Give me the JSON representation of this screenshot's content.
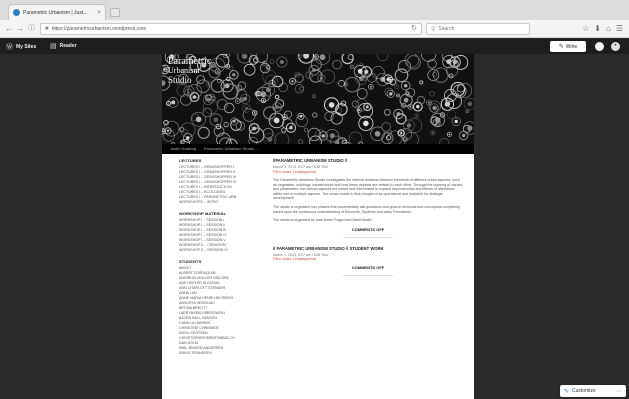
{
  "browser": {
    "tab_title": "Parametric Urbanism | Just...",
    "tab_close": "×",
    "url": "https://parametricurbanism.wordpress.com",
    "search_placeholder": "Search",
    "reload": "↻",
    "back": "←",
    "forward": "→",
    "lock": "🔒",
    "info": "ⓘ",
    "icons": [
      "☆",
      "⬇",
      "⌂",
      "☰"
    ]
  },
  "adminbar": {
    "my_sites": "My Sites",
    "reader": "Reader",
    "write": "Write"
  },
  "site": {
    "title_lines": [
      "Parametric",
      "Urbanism",
      "Studio"
    ],
    "strip_text": "Justin Hosking ...   ·   Parametric Urbanism Studio ..."
  },
  "sidebar": {
    "sections": [
      {
        "heading": "LECTURES",
        "items": [
          "LECTURES I – GRASSHOPPER I",
          "LECTURES I – GRASSHOPPER II",
          "LECTURES I – GRASSHOPPER III",
          "LECTURES I – GRASSHOPPER IV",
          "LECTURES I – INTRODUCTION",
          "LECTURES I – ECOLOGIES",
          "LECTURES I – PARAMETRIC URB.",
          "WORKSHOPS – INTRO"
        ]
      },
      {
        "heading": "WORKSHOP MATERIAL",
        "items": [
          "WORKSHOP I – SESSION I",
          "WORKSHOP I – SESSION II",
          "WORKSHOP I – SESSION III",
          "WORKSHOP I – SESSION IV",
          "WORKSHOP I – SESSION V",
          "WORKSHOP II – CREATION",
          "WORKSHOP II – SESSION VI"
        ]
      },
      {
        "heading": "STUDENTS",
        "items": [
          "ABOUT",
          "ALBERT ZORRAQUIN",
          "ANDREAS MOLLER NIELSEN",
          "ANE HEPLER KLOCKAD",
          "ANN-CHARLOTT STENDER",
          "ANNA LAN",
          "ANNE MARIA HENRI HELTBERG",
          "ANSURYA HEROUAU",
          "BETINA BREOTT",
          "LAERYNSEKLI BRISOWSKI",
          "BJORN BALL HANSEN",
          "CAMILLA HANSEN",
          "CHRISTINE CHRISMER",
          "NICKL CERTSEN",
          "CHRISTOPHER BRINTONBOLCH",
          "DAN HOLM",
          "EMIL JENSEN ANDERSEN",
          "EMILIE FRANDSEN"
        ]
      }
    ]
  },
  "posts": [
    {
      "title": "//PARAMETRIC URBANISM STUDIO //",
      "meta_line1": "March 1, 2013, 8:07 am / Edit This",
      "meta_line2": "Filed under: Uncategorized",
      "paragraphs": [
        "The Parametric Urbanism Studio investigates the internal relations between elements of different urban aspects, such as vegetation, buildings, infrastructure and how these aspects are related to each other. Through the layering of visuals and parameters, the various aspects are sorted and interrelated to expand dependencies and effects of alterations within one or multiple aspects. The urban model is thus thought of as operational and readable for strategic development.",
        "The studio is organised into phases that incrementally ask questions and grow in technical and conceptual complexity, based upon the continuous understanding of Elements, Systems and lastly Formations.",
        "The studio is organised by Isak Worre Foged and Marie Bodin."
      ],
      "comments": "COMMENTS OFF"
    },
    {
      "title": "// PARAMETRIC URBANISM STUDIO // STUDENT WORK",
      "meta_line1": "March 1, 2013, 8:07 am / Edit This",
      "meta_line2": "Filed under: Uncategorized",
      "paragraphs": [],
      "comments": "COMMENTS OFF"
    }
  ],
  "customize": {
    "label": "Customize",
    "more": "⋯"
  }
}
